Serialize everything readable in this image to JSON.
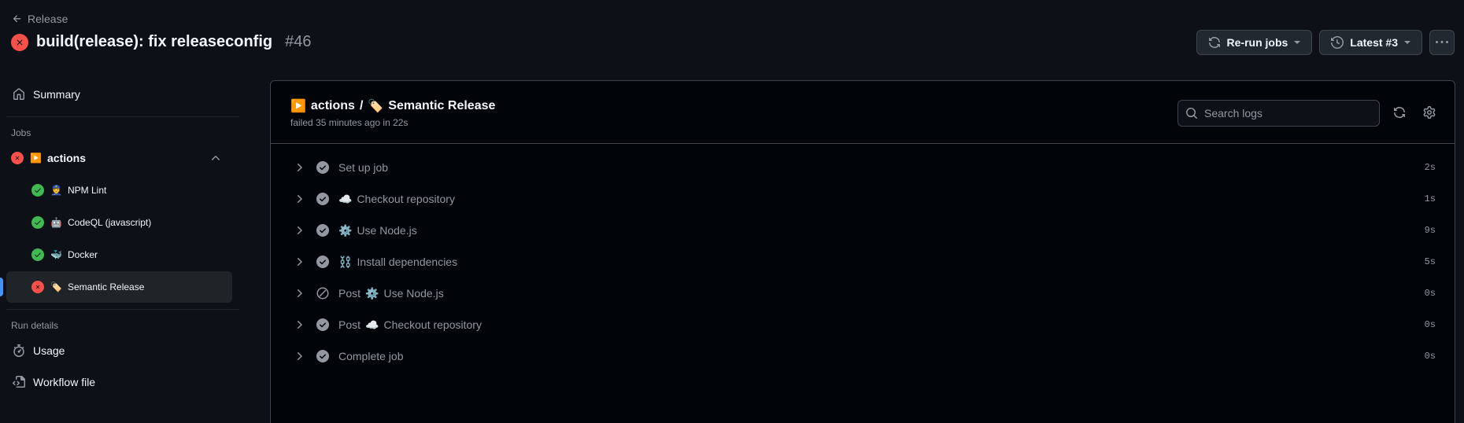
{
  "header": {
    "back_label": "Release",
    "run_title": "build(release): fix releaseconfig",
    "run_number": "#46",
    "rerun_label": "Re-run jobs",
    "latest_label": "Latest #3"
  },
  "sidebar": {
    "summary_label": "Summary",
    "jobs_heading": "Jobs",
    "job_group": {
      "emoji": "▶️",
      "label": "actions",
      "status": "failed"
    },
    "jobs": [
      {
        "emoji": "👮",
        "label": "NPM Lint",
        "status": "success"
      },
      {
        "emoji": "🤖",
        "label": "CodeQL (javascript)",
        "status": "success"
      },
      {
        "emoji": "🐳",
        "label": "Docker",
        "status": "success"
      },
      {
        "emoji": "🏷️",
        "label": "Semantic Release",
        "status": "failed"
      }
    ],
    "run_details_heading": "Run details",
    "usage_label": "Usage",
    "workflow_label": "Workflow file"
  },
  "job": {
    "group_emoji": "▶️",
    "group": "actions",
    "separator": "/",
    "emoji": "🏷️",
    "name": "Semantic Release",
    "status_line": "failed 35 minutes ago in 22s"
  },
  "search": {
    "placeholder": "Search logs"
  },
  "steps": [
    {
      "prefix": "",
      "emoji": "",
      "name": "Set up job",
      "duration": "2s",
      "state": "success"
    },
    {
      "prefix": "",
      "emoji": "☁️",
      "name": "Checkout repository",
      "duration": "1s",
      "state": "success"
    },
    {
      "prefix": "",
      "emoji": "⚙️",
      "name": "Use Node.js",
      "duration": "9s",
      "state": "success"
    },
    {
      "prefix": "",
      "emoji": "⛓️",
      "name": "Install dependencies",
      "duration": "5s",
      "state": "success"
    },
    {
      "prefix": "Post",
      "emoji": "⚙️",
      "name": "Use Node.js",
      "duration": "0s",
      "state": "skipped"
    },
    {
      "prefix": "Post",
      "emoji": "☁️",
      "name": "Checkout repository",
      "duration": "0s",
      "state": "success"
    },
    {
      "prefix": "",
      "emoji": "",
      "name": "Complete job",
      "duration": "0s",
      "state": "success"
    }
  ],
  "colors": {
    "background": "#0d1117",
    "success": "#3fb950",
    "failure": "#f85149",
    "accent": "#4493f8"
  }
}
